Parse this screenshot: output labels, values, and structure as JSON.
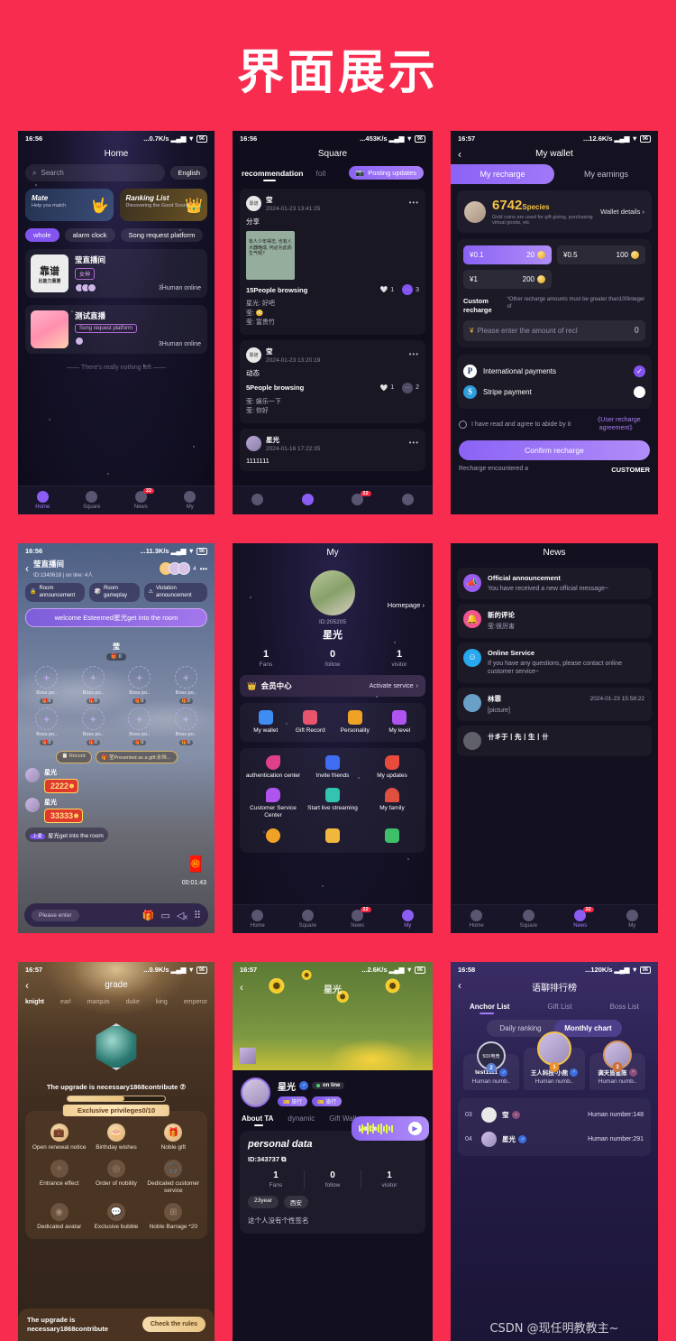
{
  "header": {
    "title": "界面展示"
  },
  "watermark": "CSDN @现任明教教主~",
  "screens": {
    "home": {
      "status": {
        "time": "16:56",
        "speed": "...0.7K/s",
        "battery": "96"
      },
      "nav_title": "Home",
      "search_placeholder": "Search",
      "language_button": "English",
      "banners": [
        {
          "title": "Mate",
          "subtitle": "Help you match",
          "icon": "hand-heart-icon"
        },
        {
          "title": "Ranking List",
          "subtitle": "Discovering the Good Sound",
          "icon": "crown-icon"
        }
      ],
      "tags": [
        "whole",
        "alarm clock",
        "Song request platform"
      ],
      "rooms": [
        {
          "thumb_text": "靠谱",
          "thumb_sub": "比能力重要",
          "name": "莹直播间",
          "tag": "女神",
          "online": "3Human online"
        },
        {
          "thumb_text": "",
          "thumb_sub": "",
          "name": "测试直播",
          "tag": "Song request platform",
          "online": "3Human online"
        }
      ],
      "empty_text": "There's really nothing left",
      "tabs": [
        {
          "label": "Home",
          "active": true,
          "badge": ""
        },
        {
          "label": "Square",
          "active": false,
          "badge": ""
        },
        {
          "label": "News",
          "active": false,
          "badge": "22"
        },
        {
          "label": "My",
          "active": false,
          "badge": ""
        }
      ]
    },
    "square": {
      "status": {
        "time": "16:56",
        "speed": "...453K/s",
        "battery": "96"
      },
      "nav_title": "Square",
      "tabs": [
        "recommendation",
        "foll"
      ],
      "post_button": "Posting updates",
      "posts": [
        {
          "name": "莹",
          "time": "2024-01-23 13:41:25",
          "text": "分享",
          "image_text": "有人少年得志, 也有人大器晚成, 何必为此而生气呢?",
          "views": "15People browsing",
          "likes": "1",
          "comments": "3",
          "comment_lines": [
            "星光: 好吧",
            "莹: 😳",
            "莹: 富贵竹"
          ]
        },
        {
          "name": "莹",
          "time": "2024-01-23 13:20:19",
          "text": "动态",
          "views": "5People browsing",
          "likes": "1",
          "comments": "2",
          "comment_lines": [
            "莹: 娱乐一下",
            "莹: 你好"
          ]
        },
        {
          "name": "星光",
          "time": "2024-01-16 17:22:35",
          "text": "1111111"
        }
      ],
      "tabs_bottom": [
        {
          "label": "Home",
          "active": false,
          "badge": ""
        },
        {
          "label": "Square",
          "active": true,
          "badge": ""
        },
        {
          "label": "News",
          "active": false,
          "badge": "22"
        },
        {
          "label": "My",
          "active": false,
          "badge": ""
        }
      ]
    },
    "wallet": {
      "status": {
        "time": "16:57",
        "speed": "...12.6K/s",
        "battery": "96"
      },
      "nav_title": "My wallet",
      "tabs": [
        "My recharge",
        "My earnings"
      ],
      "balance": "6742",
      "balance_unit": "Species",
      "balance_desc": "Gold coins are used for gift giving, purchasing virtual goods, etc",
      "details_link": "Wallet details",
      "options": [
        {
          "price": "¥0.1",
          "coins": "20",
          "selected": true
        },
        {
          "price": "¥0.5",
          "coins": "100",
          "selected": false
        },
        {
          "price": "¥1",
          "coins": "200",
          "selected": false
        }
      ],
      "custom_label": "Custom recharge",
      "custom_note": "*Other recharge amounts must be greater than100integer of",
      "custom_placeholder": "Please enter the amount of recl",
      "custom_value": "0",
      "payments": [
        {
          "name": "International payments",
          "logo": "P",
          "selected": true
        },
        {
          "name": "Stripe payment",
          "logo": "S",
          "selected": false
        }
      ],
      "agree_text": "I have read and agree to abide by it",
      "agree_link": "《User recharge agreement》",
      "confirm_button": "Confirm recharge",
      "footer_left": "Recharge encountered a",
      "footer_right": "CUSTOMER"
    },
    "live": {
      "status": {
        "time": "16:56",
        "speed": "...11.3K/s",
        "battery": "96"
      },
      "room_title": "莹直播间",
      "room_sub": "ID:1340618 | on line: 4人",
      "viewer_count": "4",
      "chips": [
        "Room announcement",
        "Room gameplay",
        "Violation announcement"
      ],
      "welcome": "welcome Esteemed星光get into the room",
      "host_name": "莹",
      "host_coins": "0",
      "seat_label": "Boss po..",
      "seat_coins": "0",
      "seat_count": 8,
      "pills": [
        "Record",
        "莹Presented as a gift:永恒..."
      ],
      "chats": [
        {
          "name": "星光",
          "gift": "2222"
        },
        {
          "name": "星光",
          "gift": "33333"
        }
      ],
      "enter_msg": "星光get into the room",
      "enter_level": "上麦",
      "timer": "00:01:43",
      "input_placeholder": "Please enter"
    },
    "my": {
      "nav_title": "My",
      "user_id": "ID:205205",
      "user_name": "星光",
      "homepage_link": "Homepage",
      "stats": [
        {
          "value": "1",
          "label": "Fans"
        },
        {
          "value": "0",
          "label": "follow"
        },
        {
          "value": "1",
          "label": "visitor"
        }
      ],
      "vip_label": "会员中心",
      "vip_action": "Activate service",
      "quick_menu": [
        {
          "label": "My wallet",
          "icon": "wallet-icon",
          "color": "#3f8cf2"
        },
        {
          "label": "Gift Record",
          "icon": "gift-icon",
          "color": "#e8546c"
        },
        {
          "label": "Personality",
          "icon": "crown-icon",
          "color": "#f0a226"
        },
        {
          "label": "My level",
          "icon": "level-icon",
          "color": "#b054f0"
        }
      ],
      "menu": [
        {
          "label": "authentication center",
          "icon": "shield-check-icon",
          "color": "#e0408a"
        },
        {
          "label": "Invite friends",
          "icon": "envelope-icon",
          "color": "#3f6ef2"
        },
        {
          "label": "My updates",
          "icon": "camera-icon",
          "color": "#e84a3c"
        },
        {
          "label": "Customer Service Center",
          "icon": "chat-icon",
          "color": "#b054f0"
        },
        {
          "label": "Start live streaming",
          "icon": "broadcast-icon",
          "color": "#32c4b0"
        },
        {
          "label": "My family",
          "icon": "house-icon",
          "color": "#e05040"
        },
        {
          "label": "",
          "icon": "bell-icon",
          "color": "#f0a226"
        },
        {
          "label": "",
          "icon": "card-icon",
          "color": "#f0b73e"
        },
        {
          "label": "",
          "icon": "leaf-icon",
          "color": "#3ec06a"
        }
      ],
      "tabs": [
        {
          "label": "Home",
          "active": false,
          "badge": ""
        },
        {
          "label": "Square",
          "active": false,
          "badge": ""
        },
        {
          "label": "News",
          "active": false,
          "badge": "22"
        },
        {
          "label": "My",
          "active": true,
          "badge": ""
        }
      ]
    },
    "news": {
      "nav_title": "News",
      "items": [
        {
          "title": "Official announcement",
          "desc": "You have received a new official message~",
          "icon": "megaphone-icon",
          "color": "#9b5cf0",
          "time": ""
        },
        {
          "title": "新的评论",
          "desc": "莹:很厉害",
          "icon": "bell-icon",
          "color": "#f0558f",
          "time": ""
        },
        {
          "title": "Online Service",
          "desc": "If you have any questions, please contact online customer service~",
          "icon": "service-icon",
          "color": "#28a8ee",
          "time": ""
        },
        {
          "title": "林霏",
          "desc": "[picture]",
          "icon": "avatar-icon",
          "color": "#6aa0c8",
          "time": "2024-01-23 15:58:22"
        },
        {
          "title": "卄丯于丨先丨生丨卄",
          "desc": "",
          "icon": "avatar-icon",
          "color": "#60606a",
          "time": ""
        }
      ],
      "tabs": [
        {
          "label": "Home",
          "active": false,
          "badge": ""
        },
        {
          "label": "Square",
          "active": false,
          "badge": ""
        },
        {
          "label": "News",
          "active": true,
          "badge": "22"
        },
        {
          "label": "My",
          "active": false,
          "badge": ""
        }
      ]
    },
    "grade": {
      "status": {
        "time": "16:57",
        "speed": "...0.9K/s",
        "battery": "96"
      },
      "nav_title": "grade",
      "levels": [
        "knight",
        "earl",
        "marquis",
        "duke",
        "king",
        "emperor"
      ],
      "upgrade_text": "The upgrade is necessary1868contribute",
      "privileges_title": "Exclusive privileges0/10",
      "privileges": [
        {
          "label": "Open renewal notice",
          "icon": "briefcase-icon",
          "on": true
        },
        {
          "label": "Birthday wishes",
          "icon": "cake-icon",
          "on": true
        },
        {
          "label": "Noble gift",
          "icon": "gift-icon",
          "on": true
        },
        {
          "label": "Entrance effect",
          "icon": "star-icon",
          "on": false
        },
        {
          "label": "Order of nobility",
          "icon": "medal-icon",
          "on": false
        },
        {
          "label": "Dedicated customer service",
          "icon": "headset-icon",
          "on": false
        },
        {
          "label": "Dedicated avatar",
          "icon": "avatar-frame-icon",
          "on": false
        },
        {
          "label": "Exclusive bubble",
          "icon": "bubble-icon",
          "on": false
        },
        {
          "label": "Noble Barrage *20",
          "icon": "barrage-icon",
          "on": false
        }
      ],
      "footer_text": "The upgrade is necessary1868contribute",
      "footer_button": "Check the rules"
    },
    "personal": {
      "status": {
        "time": "16:57",
        "speed": "...2.6K/s",
        "battery": "96"
      },
      "hero_name": "星光",
      "name": "星光",
      "online_label": "on line",
      "badges": [
        "旅行",
        "旅行"
      ],
      "tabs": [
        "About TA",
        "dynamic",
        "Gift Wall"
      ],
      "voice_label": "Voice",
      "card_title": "personal data",
      "id": "ID:343737",
      "stats": [
        {
          "value": "1",
          "label": "Fans"
        },
        {
          "value": "0",
          "label": "follow"
        },
        {
          "value": "1",
          "label": "visitor"
        }
      ],
      "chips": [
        "23year",
        "西安"
      ],
      "signature": "这个人没有个性签名"
    },
    "ranking": {
      "status": {
        "time": "16:58",
        "speed": "...120K/s",
        "battery": "96"
      },
      "nav_title": "语聊排行榜",
      "tabs": [
        "Anchor List",
        "Gift List",
        "Boss List"
      ],
      "segments": [
        "Daily ranking",
        "Monthly chart"
      ],
      "podium": [
        {
          "rank": "2",
          "name": "test1111",
          "number": "Human numb..",
          "gender": "m",
          "avatar_text": "50X电竞"
        },
        {
          "rank": "1",
          "name": "王人科技-小熊",
          "number": "Human numb..",
          "gender": "m",
          "avatar_text": ""
        },
        {
          "rank": "3",
          "name": "满天皆星陈",
          "number": "Human numb..",
          "gender": "f",
          "avatar_text": ""
        }
      ],
      "rows": [
        {
          "no": "03",
          "name": "莹",
          "gender": "f",
          "number": "Human number:148"
        },
        {
          "no": "04",
          "name": "星光",
          "gender": "m",
          "number": "Human number:291"
        }
      ]
    }
  }
}
